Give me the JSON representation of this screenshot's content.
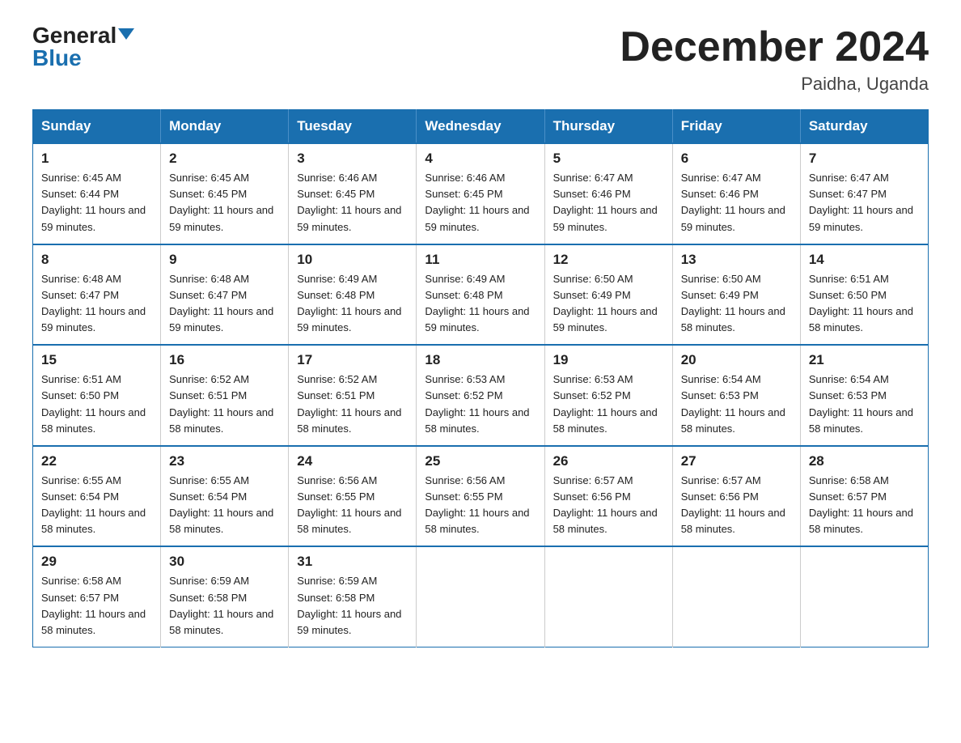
{
  "logo": {
    "general": "General",
    "blue": "Blue"
  },
  "title": "December 2024",
  "location": "Paidha, Uganda",
  "days_header": [
    "Sunday",
    "Monday",
    "Tuesday",
    "Wednesday",
    "Thursday",
    "Friday",
    "Saturday"
  ],
  "weeks": [
    [
      {
        "day": "1",
        "sunrise": "6:45 AM",
        "sunset": "6:44 PM",
        "daylight": "11 hours and 59 minutes."
      },
      {
        "day": "2",
        "sunrise": "6:45 AM",
        "sunset": "6:45 PM",
        "daylight": "11 hours and 59 minutes."
      },
      {
        "day": "3",
        "sunrise": "6:46 AM",
        "sunset": "6:45 PM",
        "daylight": "11 hours and 59 minutes."
      },
      {
        "day": "4",
        "sunrise": "6:46 AM",
        "sunset": "6:45 PM",
        "daylight": "11 hours and 59 minutes."
      },
      {
        "day": "5",
        "sunrise": "6:47 AM",
        "sunset": "6:46 PM",
        "daylight": "11 hours and 59 minutes."
      },
      {
        "day": "6",
        "sunrise": "6:47 AM",
        "sunset": "6:46 PM",
        "daylight": "11 hours and 59 minutes."
      },
      {
        "day": "7",
        "sunrise": "6:47 AM",
        "sunset": "6:47 PM",
        "daylight": "11 hours and 59 minutes."
      }
    ],
    [
      {
        "day": "8",
        "sunrise": "6:48 AM",
        "sunset": "6:47 PM",
        "daylight": "11 hours and 59 minutes."
      },
      {
        "day": "9",
        "sunrise": "6:48 AM",
        "sunset": "6:47 PM",
        "daylight": "11 hours and 59 minutes."
      },
      {
        "day": "10",
        "sunrise": "6:49 AM",
        "sunset": "6:48 PM",
        "daylight": "11 hours and 59 minutes."
      },
      {
        "day": "11",
        "sunrise": "6:49 AM",
        "sunset": "6:48 PM",
        "daylight": "11 hours and 59 minutes."
      },
      {
        "day": "12",
        "sunrise": "6:50 AM",
        "sunset": "6:49 PM",
        "daylight": "11 hours and 59 minutes."
      },
      {
        "day": "13",
        "sunrise": "6:50 AM",
        "sunset": "6:49 PM",
        "daylight": "11 hours and 58 minutes."
      },
      {
        "day": "14",
        "sunrise": "6:51 AM",
        "sunset": "6:50 PM",
        "daylight": "11 hours and 58 minutes."
      }
    ],
    [
      {
        "day": "15",
        "sunrise": "6:51 AM",
        "sunset": "6:50 PM",
        "daylight": "11 hours and 58 minutes."
      },
      {
        "day": "16",
        "sunrise": "6:52 AM",
        "sunset": "6:51 PM",
        "daylight": "11 hours and 58 minutes."
      },
      {
        "day": "17",
        "sunrise": "6:52 AM",
        "sunset": "6:51 PM",
        "daylight": "11 hours and 58 minutes."
      },
      {
        "day": "18",
        "sunrise": "6:53 AM",
        "sunset": "6:52 PM",
        "daylight": "11 hours and 58 minutes."
      },
      {
        "day": "19",
        "sunrise": "6:53 AM",
        "sunset": "6:52 PM",
        "daylight": "11 hours and 58 minutes."
      },
      {
        "day": "20",
        "sunrise": "6:54 AM",
        "sunset": "6:53 PM",
        "daylight": "11 hours and 58 minutes."
      },
      {
        "day": "21",
        "sunrise": "6:54 AM",
        "sunset": "6:53 PM",
        "daylight": "11 hours and 58 minutes."
      }
    ],
    [
      {
        "day": "22",
        "sunrise": "6:55 AM",
        "sunset": "6:54 PM",
        "daylight": "11 hours and 58 minutes."
      },
      {
        "day": "23",
        "sunrise": "6:55 AM",
        "sunset": "6:54 PM",
        "daylight": "11 hours and 58 minutes."
      },
      {
        "day": "24",
        "sunrise": "6:56 AM",
        "sunset": "6:55 PM",
        "daylight": "11 hours and 58 minutes."
      },
      {
        "day": "25",
        "sunrise": "6:56 AM",
        "sunset": "6:55 PM",
        "daylight": "11 hours and 58 minutes."
      },
      {
        "day": "26",
        "sunrise": "6:57 AM",
        "sunset": "6:56 PM",
        "daylight": "11 hours and 58 minutes."
      },
      {
        "day": "27",
        "sunrise": "6:57 AM",
        "sunset": "6:56 PM",
        "daylight": "11 hours and 58 minutes."
      },
      {
        "day": "28",
        "sunrise": "6:58 AM",
        "sunset": "6:57 PM",
        "daylight": "11 hours and 58 minutes."
      }
    ],
    [
      {
        "day": "29",
        "sunrise": "6:58 AM",
        "sunset": "6:57 PM",
        "daylight": "11 hours and 58 minutes."
      },
      {
        "day": "30",
        "sunrise": "6:59 AM",
        "sunset": "6:58 PM",
        "daylight": "11 hours and 58 minutes."
      },
      {
        "day": "31",
        "sunrise": "6:59 AM",
        "sunset": "6:58 PM",
        "daylight": "11 hours and 59 minutes."
      },
      null,
      null,
      null,
      null
    ]
  ]
}
